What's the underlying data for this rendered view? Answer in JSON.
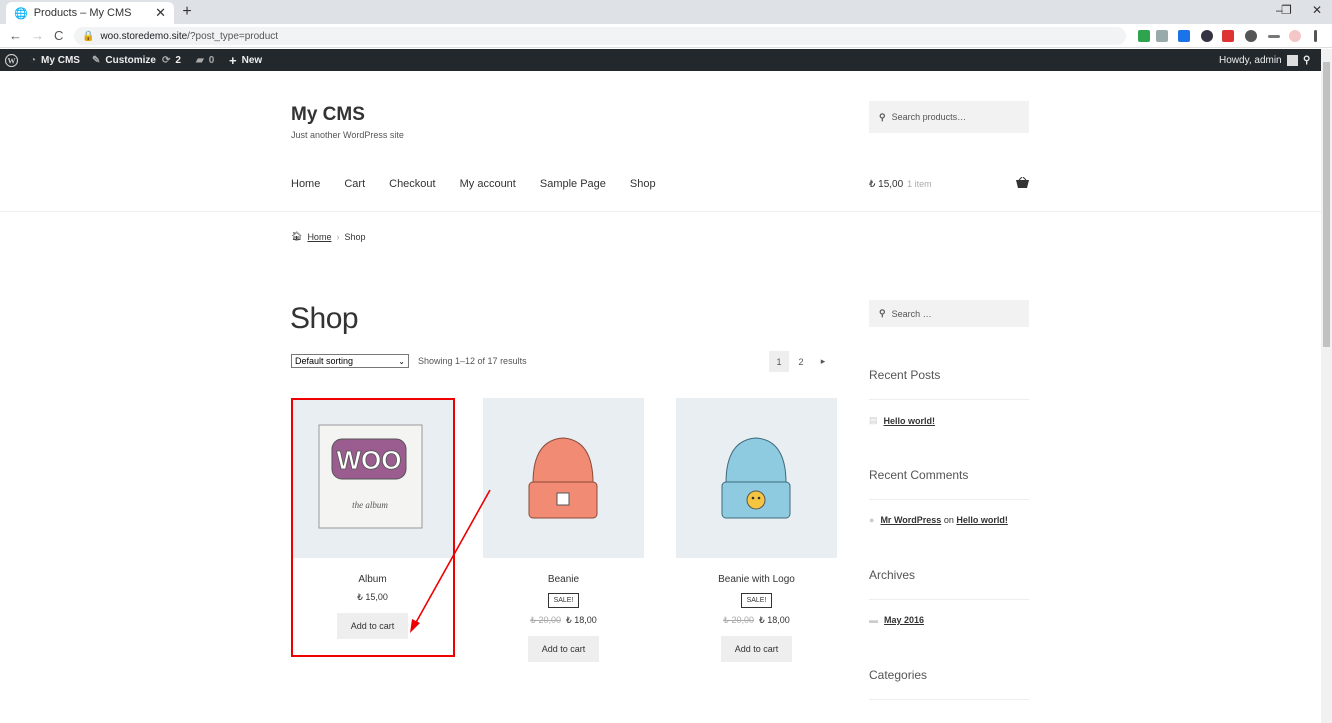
{
  "browser": {
    "tab_title": "Products – My CMS",
    "tab_close": "✕",
    "new_tab": "+",
    "url_host": "woo.storedemo.site",
    "url_path": "/?post_type=product",
    "window_controls": [
      "–",
      "❐",
      "✕"
    ],
    "nav": {
      "back": "←",
      "forward": "→",
      "reload": "C"
    }
  },
  "admin_bar": {
    "site": "My CMS",
    "customize": "Customize",
    "updates": "2",
    "comments": "0",
    "new": "New",
    "howdy": "Howdy, admin"
  },
  "site": {
    "title": "My CMS",
    "tagline": "Just another WordPress site",
    "search_placeholder": "Search products…"
  },
  "menu": [
    "Home",
    "Cart",
    "Checkout",
    "My account",
    "Sample Page",
    "Shop"
  ],
  "header_cart": {
    "total": "₺ 15,00",
    "count": "1 item"
  },
  "breadcrumb": {
    "home": "Home",
    "sep": "›",
    "current": "Shop"
  },
  "shop": {
    "title": "Shop",
    "sorting": "Default sorting",
    "result_count": "Showing 1–12 of 17 results",
    "pages": [
      "1",
      "2",
      "▸"
    ]
  },
  "products": [
    {
      "name": "Album",
      "price": "₺ 15,00",
      "sale": "",
      "old_price": "",
      "button": "Add to cart"
    },
    {
      "name": "Beanie",
      "price": "₺ 18,00",
      "sale": "SALE!",
      "old_price": "₺ 20,00",
      "button": "Add to cart"
    },
    {
      "name": "Beanie with Logo",
      "price": "₺ 18,00",
      "sale": "SALE!",
      "old_price": "₺ 20,00",
      "button": "Add to cart"
    }
  ],
  "album_art": {
    "logo": "WOO",
    "caption": "the album"
  },
  "sidebar": {
    "search_placeholder": "Search …",
    "recent_posts_title": "Recent Posts",
    "recent_post": "Hello world!",
    "recent_comments_title": "Recent Comments",
    "comment_author": "Mr WordPress",
    "comment_on": "on",
    "comment_post": "Hello world!",
    "archives_title": "Archives",
    "archive": "May 2016",
    "categories_title": "Categories"
  },
  "colors": {
    "highlight": "#e00000",
    "admin_bar": "#23282d",
    "woo_purple": "#9b5c8f"
  }
}
